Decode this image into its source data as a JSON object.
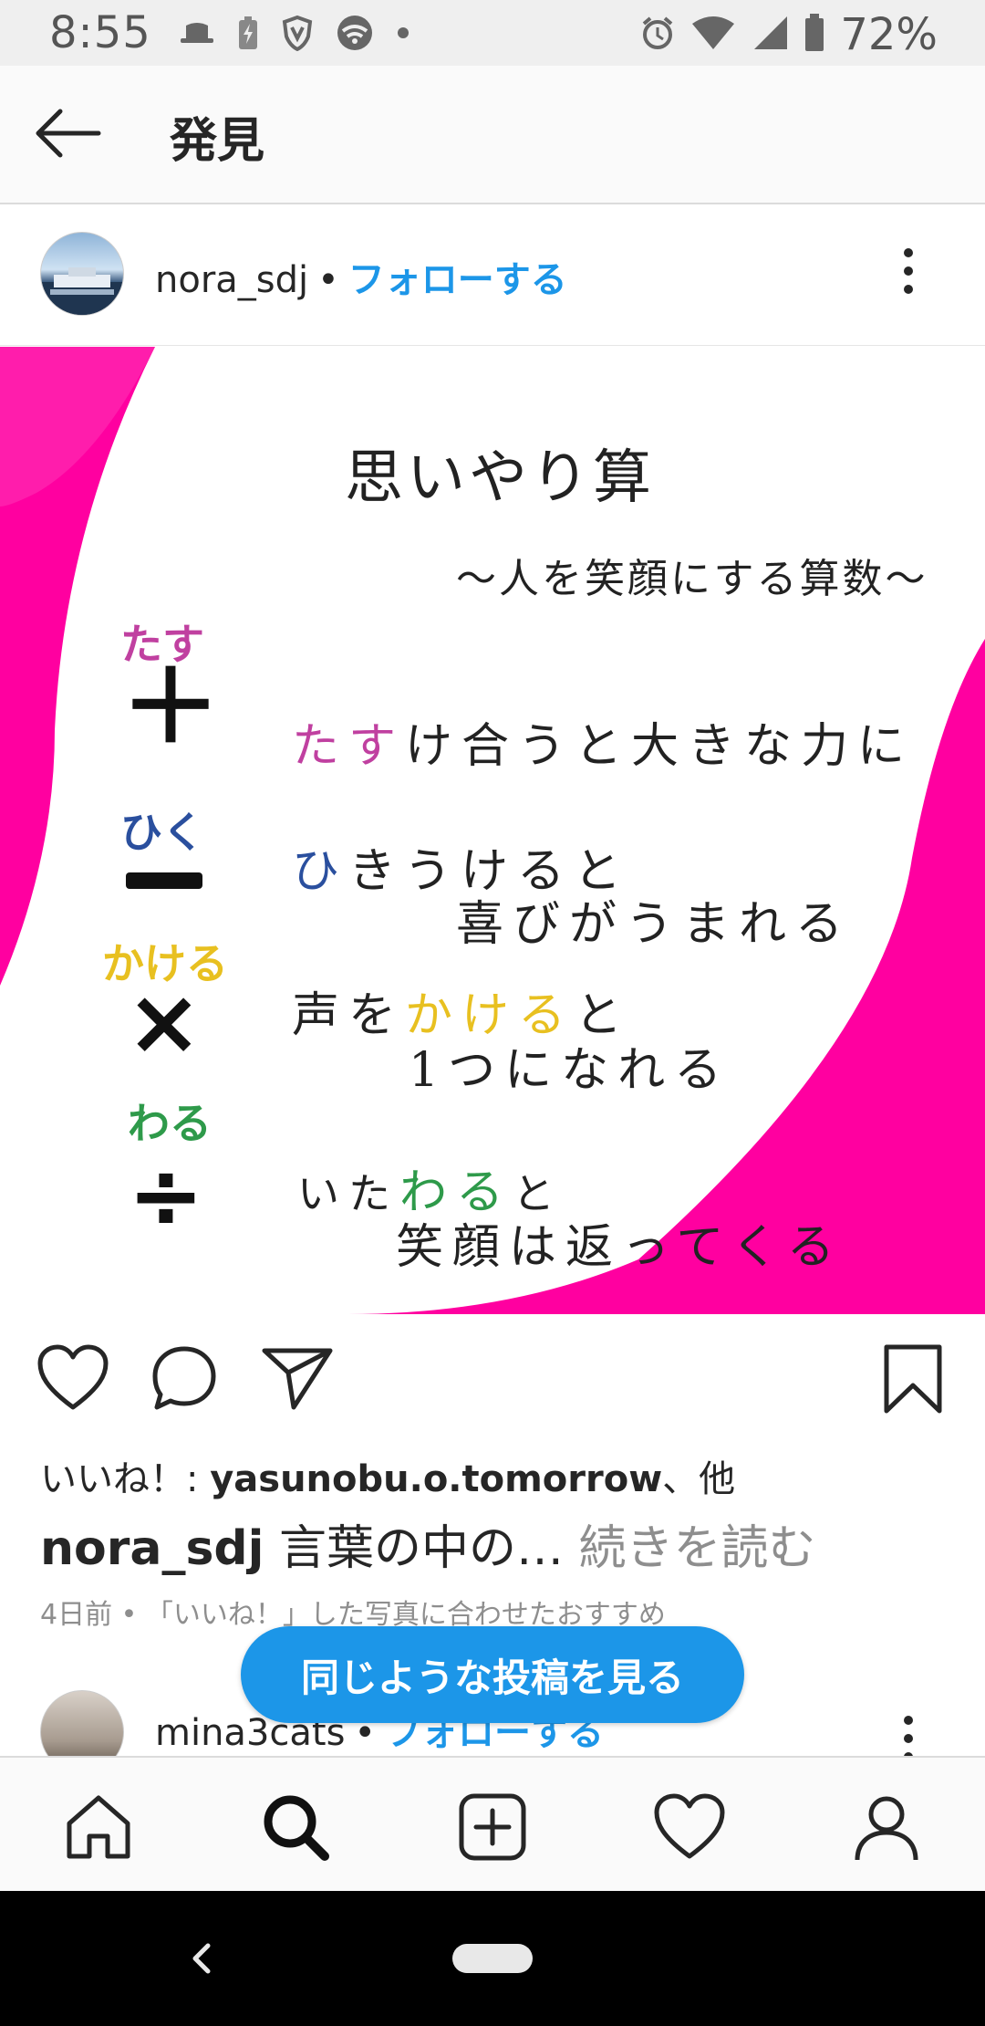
{
  "status_bar": {
    "time": "8:55",
    "battery": "72%",
    "left_icons": [
      "hat-icon",
      "battery-saver-icon",
      "vpn-shield-icon",
      "wifi-icon",
      "dot-icon"
    ],
    "right_icons": [
      "alarm-icon",
      "wifi-icon",
      "signal-icon",
      "battery-icon"
    ]
  },
  "header": {
    "title": "発見",
    "back_icon": "back-arrow-icon"
  },
  "post": {
    "username": "nora_sdj",
    "separator": "•",
    "follow_label": "フォローする",
    "image": {
      "title": "思いやり算",
      "subtitle": "〜人を笑顔にする算数〜",
      "rows": [
        {
          "label": "たす",
          "label_color": "#c040a0",
          "symbol": "＋",
          "line1_pre": "",
          "line1_highlight": "たす",
          "line1_post": "け合うと大きな力に",
          "line2": "",
          "highlight_color": "#c040a0"
        },
        {
          "label": "ひく",
          "label_color": "#2a4f9e",
          "symbol": "−",
          "line1_pre": "",
          "line1_highlight": "ひ",
          "line1_post": "きうけると",
          "line2": "喜びがうまれる",
          "highlight_color": "#2a4f9e"
        },
        {
          "label": "かける",
          "label_color": "#e8c020",
          "symbol": "×",
          "line1_pre": "声を",
          "line1_highlight": "かける",
          "line1_post": "と",
          "line2": "1つになれる",
          "highlight_color": "#e8c020"
        },
        {
          "label": "わる",
          "label_color": "#2e9a4a",
          "symbol": "÷",
          "line1_pre": "いた",
          "line1_highlight": "わる",
          "line1_post": "と",
          "line2": "笑顔は返ってくる",
          "highlight_color": "#2e9a4a"
        }
      ]
    },
    "likes_prefix": "いいね！: ",
    "likes_user": "yasunobu.o.tomorrow",
    "likes_suffix": "、他",
    "caption_user": "nora_sdj",
    "caption_text": " 言葉の中の… ",
    "read_more": "続きを読む",
    "meta": "4日前 • 「いいね！」した写真に合わせたおすすめ"
  },
  "next_post": {
    "username": "mina3cats",
    "separator": "•",
    "follow_label": "フォローする"
  },
  "similar_button": "同じような投稿を見る",
  "bottom_nav": [
    "home-icon",
    "search-icon",
    "new-post-icon",
    "activity-heart-icon",
    "profile-icon"
  ],
  "colors": {
    "accent": "#1c96e8",
    "magenta": "#ff00a0"
  }
}
